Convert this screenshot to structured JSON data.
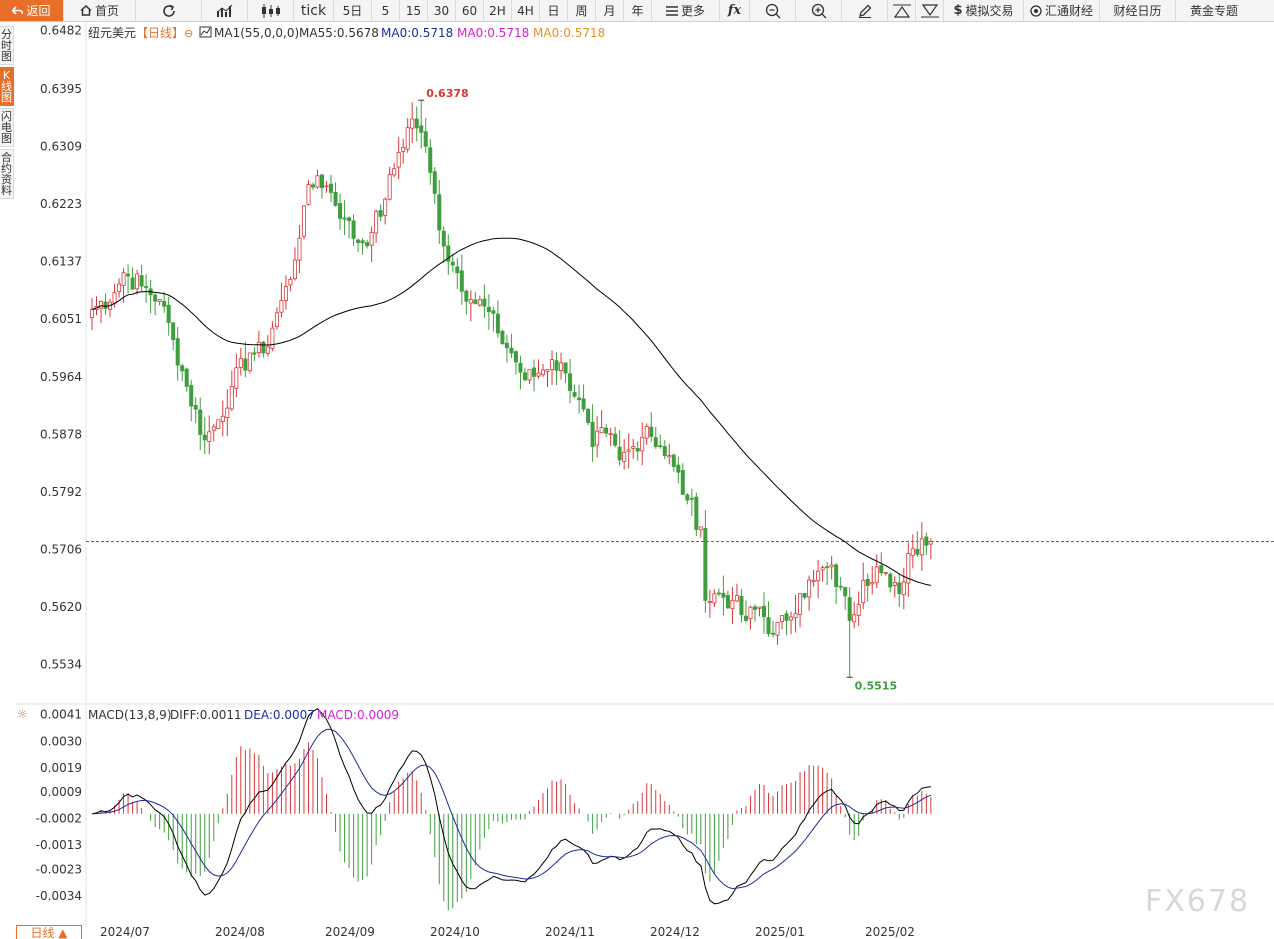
{
  "toolbar": {
    "back": "返回",
    "home": "首页",
    "tick": "tick",
    "periods": [
      "5日",
      "5",
      "15",
      "30",
      "60",
      "2H",
      "4H",
      "日",
      "周",
      "月",
      "年"
    ],
    "more": "更多",
    "sim_trade": "模拟交易",
    "hui_tong": "汇通财经",
    "calendar": "财经日历",
    "gold": "黄金专题"
  },
  "side_tabs": [
    "分时图",
    "K线图",
    "闪电图",
    "合约资料"
  ],
  "legend": {
    "symbol": "纽元美元",
    "period": "【日线】",
    "ma1": "MA1(55,0,0,0)",
    "ma55": "MA55:0.5678",
    "ma0_a": "MA0:0.5718",
    "ma0_b": "MA0:0.5718",
    "ma0_c": "MA0:0.5718"
  },
  "macd_legend": {
    "name": "MACD(13,8,9)",
    "diff": "DIFF:0.0011",
    "dea": "DEA:0.0007",
    "macd": "MACD:0.0009"
  },
  "annotations": {
    "high": "0.6378",
    "low": "0.5515"
  },
  "period_button": "日线 ▲",
  "watermark": "FX678",
  "colors": {
    "up": "#d9383a",
    "down": "#3e9e3e",
    "accent": "#e86f2a",
    "ma": "#000000",
    "dea": "#1c2c9c",
    "macd": "#d620d6",
    "cur_line": "#3a6fc4"
  },
  "chart_data": {
    "type": "candlestick",
    "price_axis": {
      "ticks": [
        0.6482,
        0.6395,
        0.6309,
        0.6223,
        0.6137,
        0.6051,
        0.5964,
        0.5878,
        0.5792,
        0.5706,
        0.562,
        0.5534
      ],
      "min": 0.5475,
      "max": 0.6495
    },
    "macd_axis": {
      "ticks": [
        0.0041,
        0.003,
        0.0019,
        0.0009,
        -0.0002,
        -0.0013,
        -0.0023,
        -0.0034
      ],
      "min": -0.0046,
      "max": 0.0045
    },
    "x_labels": [
      "2024/07",
      "2024/08",
      "2024/09",
      "2024/10",
      "2024/11",
      "2024/12",
      "2025/01",
      "2025/02"
    ],
    "current_price": 0.5718,
    "close_anchors": [
      [
        0,
        0.6065
      ],
      [
        5,
        0.609
      ],
      [
        7,
        0.612
      ],
      [
        11,
        0.61
      ],
      [
        15,
        0.608
      ],
      [
        18,
        0.602
      ],
      [
        21,
        0.595
      ],
      [
        25,
        0.587
      ],
      [
        28,
        0.59
      ],
      [
        31,
        0.595
      ],
      [
        35,
        0.6
      ],
      [
        38,
        0.6
      ],
      [
        41,
        0.606
      ],
      [
        44,
        0.611
      ],
      [
        47,
        0.622
      ],
      [
        50,
        0.6265
      ],
      [
        53,
        0.624
      ],
      [
        56,
        0.62
      ],
      [
        59,
        0.6165
      ],
      [
        62,
        0.618
      ],
      [
        65,
        0.623
      ],
      [
        68,
        0.63
      ],
      [
        71,
        0.635
      ],
      [
        73,
        0.633
      ],
      [
        75,
        0.627
      ],
      [
        78,
        0.616
      ],
      [
        81,
        0.612
      ],
      [
        84,
        0.608
      ],
      [
        87,
        0.607
      ],
      [
        90,
        0.603
      ],
      [
        93,
        0.6
      ],
      [
        96,
        0.596
      ],
      [
        99,
        0.597
      ],
      [
        102,
        0.599
      ],
      [
        105,
        0.597
      ],
      [
        108,
        0.593
      ],
      [
        111,
        0.586
      ],
      [
        114,
        0.588
      ],
      [
        117,
        0.584
      ],
      [
        120,
        0.586
      ],
      [
        123,
        0.589
      ],
      [
        126,
        0.586
      ],
      [
        129,
        0.583
      ],
      [
        132,
        0.578
      ],
      [
        135,
        0.574
      ],
      [
        136,
        0.563
      ],
      [
        139,
        0.564
      ],
      [
        142,
        0.563
      ],
      [
        145,
        0.56
      ],
      [
        148,
        0.562
      ],
      [
        151,
        0.558
      ],
      [
        154,
        0.56
      ],
      [
        157,
        0.564
      ],
      [
        160,
        0.566
      ],
      [
        163,
        0.568
      ],
      [
        166,
        0.565
      ],
      [
        168,
        0.56
      ],
      [
        171,
        0.566
      ],
      [
        174,
        0.568
      ],
      [
        177,
        0.565
      ],
      [
        179,
        0.564
      ],
      [
        181,
        0.57
      ],
      [
        184,
        0.5722
      ],
      [
        186,
        0.5718
      ]
    ],
    "extrema": {
      "high": {
        "index": 73,
        "value": 0.6378
      },
      "low": {
        "index": 168,
        "value": 0.5515
      }
    }
  }
}
